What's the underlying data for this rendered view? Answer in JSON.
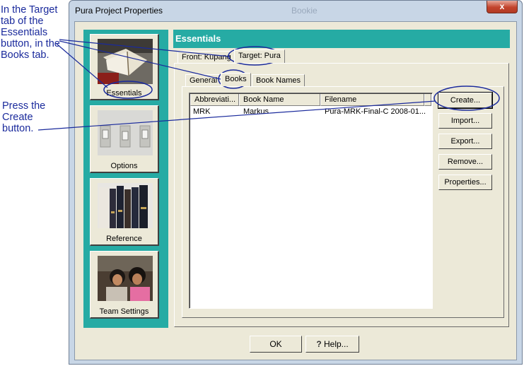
{
  "annotations": {
    "target_tab_note": "In the Target\ntab of the\nEssentials\nbutton, in the\nBooks tab.",
    "create_note": "Press the\nCreate\nbutton."
  },
  "window": {
    "title": "Pura Project Properties",
    "ghost_title": "Bookie",
    "close_glyph": "x"
  },
  "nav": {
    "essentials": "Essentials",
    "options": "Options",
    "reference": "Reference",
    "team_settings": "Team Settings"
  },
  "section": {
    "title": "Essentials"
  },
  "outer_tabs": {
    "front": "Front: Kupang",
    "target": "Target: Pura"
  },
  "inner_tabs": {
    "general": "General",
    "books": "Books",
    "book_names": "Book Names"
  },
  "list": {
    "columns": [
      "Abbreviati...",
      "Book Name",
      "Filename"
    ],
    "rows": [
      {
        "abbrev": "MRK",
        "name": "Markus",
        "filename": "Pura-MRK-Final-C 2008-01..."
      }
    ]
  },
  "actions": {
    "create": "Create...",
    "import": "Import...",
    "export": "Export...",
    "remove": "Remove...",
    "properties": "Properties..."
  },
  "footer": {
    "ok": "OK",
    "help": "Help..."
  },
  "colors": {
    "teal": "#26aba4",
    "annotation": "#1a2a9c",
    "face": "#ece9d8"
  }
}
